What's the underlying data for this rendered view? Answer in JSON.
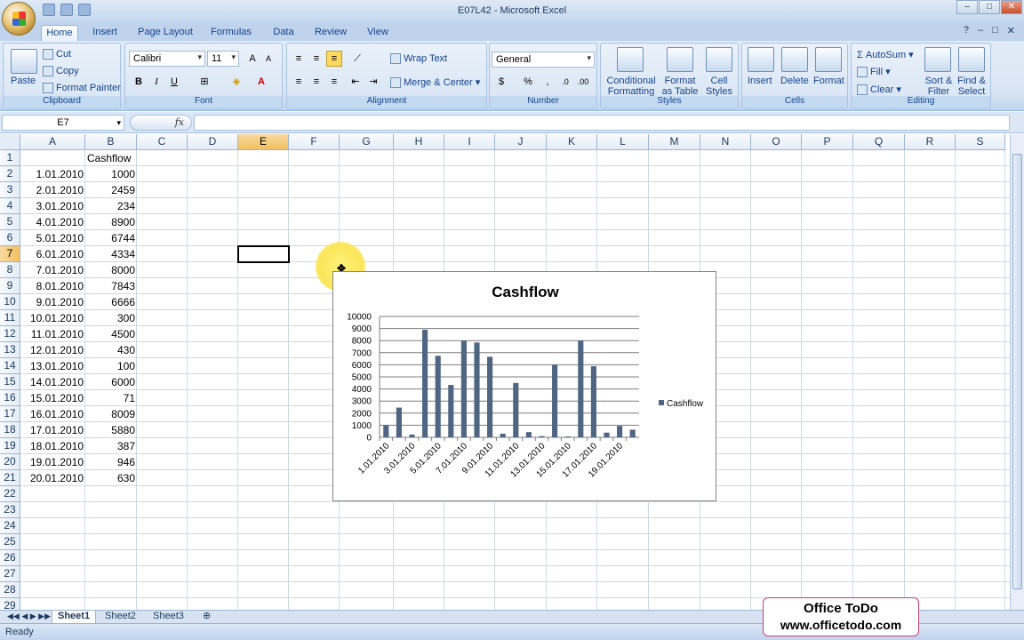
{
  "window": {
    "title": "E07L42 - Microsoft Excel"
  },
  "tabs": [
    "Home",
    "Insert",
    "Page Layout",
    "Formulas",
    "Data",
    "Review",
    "View"
  ],
  "ribbon": {
    "clipboard": {
      "label": "Clipboard",
      "paste": "Paste",
      "cut": "Cut",
      "copy": "Copy",
      "format_painter": "Format Painter"
    },
    "font": {
      "label": "Font",
      "name": "Calibri",
      "size": "11"
    },
    "alignment": {
      "label": "Alignment",
      "wrap_text": "Wrap Text",
      "merge_center": "Merge & Center"
    },
    "number": {
      "label": "Number",
      "format": "General"
    },
    "styles": {
      "label": "Styles",
      "conditional1": "Conditional",
      "conditional2": "Formatting",
      "format_table1": "Format",
      "format_table2": "as Table",
      "cell_styles1": "Cell",
      "cell_styles2": "Styles"
    },
    "cells": {
      "label": "Cells",
      "insert": "Insert",
      "delete": "Delete",
      "format": "Format"
    },
    "editing": {
      "label": "Editing",
      "autosum": "AutoSum",
      "fill": "Fill",
      "clear": "Clear",
      "sort1": "Sort &",
      "sort2": "Filter",
      "find1": "Find &",
      "find2": "Select"
    }
  },
  "formula_bar": {
    "name_box": "E7",
    "fx": "fx",
    "value": ""
  },
  "columns": [
    "A",
    "B",
    "C",
    "D",
    "E",
    "F",
    "G",
    "H",
    "I",
    "J",
    "K",
    "L",
    "M",
    "N",
    "O",
    "P",
    "Q",
    "R",
    "S"
  ],
  "rows": [
    "1",
    "2",
    "3",
    "4",
    "5",
    "6",
    "7",
    "8",
    "9",
    "10",
    "11",
    "12",
    "13",
    "14",
    "15",
    "16",
    "17",
    "18",
    "19",
    "20",
    "21",
    "22",
    "23",
    "24",
    "25",
    "26",
    "27",
    "28",
    "29"
  ],
  "cells": {
    "header_b1": "Cashflow",
    "dates": [
      "1.01.2010",
      "2.01.2010",
      "3.01.2010",
      "4.01.2010",
      "5.01.2010",
      "6.01.2010",
      "7.01.2010",
      "8.01.2010",
      "9.01.2010",
      "10.01.2010",
      "11.01.2010",
      "12.01.2010",
      "13.01.2010",
      "14.01.2010",
      "15.01.2010",
      "16.01.2010",
      "17.01.2010",
      "18.01.2010",
      "19.01.2010",
      "20.01.2010"
    ],
    "values": [
      "1000",
      "2459",
      "234",
      "8900",
      "6744",
      "4334",
      "8000",
      "7843",
      "6666",
      "300",
      "4500",
      "430",
      "100",
      "6000",
      "71",
      "8009",
      "5880",
      "387",
      "946",
      "630"
    ]
  },
  "chart_data": {
    "type": "bar",
    "title": "Cashflow",
    "categories": [
      "1.01.2010",
      "2.01.2010",
      "3.01.2010",
      "4.01.2010",
      "5.01.2010",
      "6.01.2010",
      "7.01.2010",
      "8.01.2010",
      "9.01.2010",
      "10.01.2010",
      "11.01.2010",
      "12.01.2010",
      "13.01.2010",
      "14.01.2010",
      "15.01.2010",
      "16.01.2010",
      "17.01.2010",
      "18.01.2010",
      "19.01.2010",
      "20.01.2010"
    ],
    "x_tick_labels": [
      "1.01.2010",
      "3.01.2010",
      "5.01.2010",
      "7.01.2010",
      "9.01.2010",
      "11.01.2010",
      "13.01.2010",
      "15.01.2010",
      "17.01.2010",
      "19.01.2010"
    ],
    "series": [
      {
        "name": "Cashflow",
        "values": [
          1000,
          2459,
          234,
          8900,
          6744,
          4334,
          8000,
          7843,
          6666,
          300,
          4500,
          430,
          100,
          6000,
          71,
          8009,
          5880,
          387,
          946,
          630
        ]
      }
    ],
    "y_ticks": [
      "0",
      "1000",
      "2000",
      "3000",
      "4000",
      "5000",
      "6000",
      "7000",
      "8000",
      "9000",
      "10000"
    ],
    "ylim": [
      0,
      10000
    ],
    "grid": true,
    "legend": "right",
    "bar_color": "#4f6581"
  },
  "sheets": [
    "Sheet1",
    "Sheet2",
    "Sheet3"
  ],
  "status": "Ready",
  "watermark": {
    "line1": "Office ToDo",
    "line2": "www.officetodo.com"
  }
}
